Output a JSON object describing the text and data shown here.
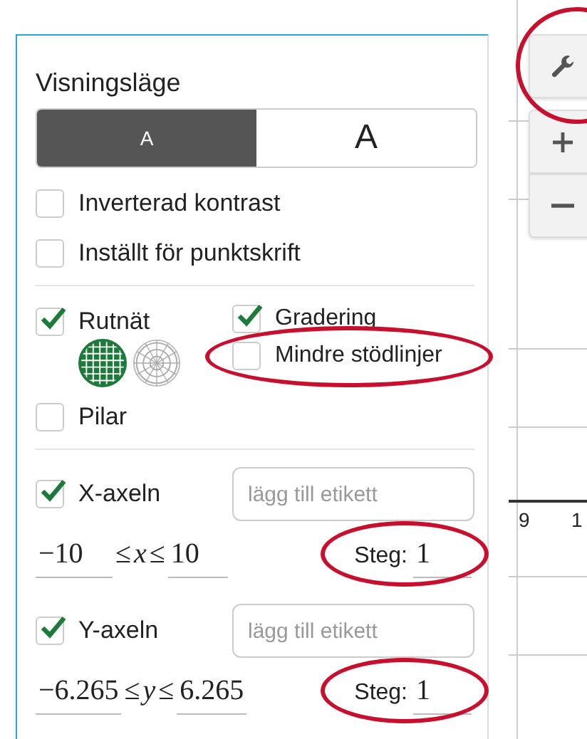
{
  "settings_panel": {
    "title": "Visningsläge",
    "display_modes": [
      {
        "label": "A",
        "kind": "small",
        "selected": true
      },
      {
        "label": "A",
        "kind": "large",
        "selected": false
      }
    ],
    "options": [
      {
        "label": "Inverterad kontrast",
        "checked": false
      },
      {
        "label": "Inställt för punktskrift",
        "checked": false
      }
    ],
    "grid": {
      "label": "Rutnät",
      "checked": true,
      "grid_types": [
        {
          "kind": "cartesian",
          "selected": true
        },
        {
          "kind": "polar",
          "selected": false
        }
      ],
      "sub_options": [
        {
          "label": "Gradering",
          "checked": true,
          "highlighted": false
        },
        {
          "label": "Mindre stödlinjer",
          "checked": false,
          "highlighted": true
        }
      ]
    },
    "arrows": {
      "label": "Pilar",
      "checked": false
    },
    "axes": [
      {
        "label": "X-axeln",
        "checked": true,
        "placeholder": "lägg till etikett",
        "min": "−10",
        "relations": [
          "≤",
          "≤"
        ],
        "variable": "x",
        "max": "10",
        "step_label": "Steg:",
        "step": "1",
        "step_highlighted": true
      },
      {
        "label": "Y-axeln",
        "checked": true,
        "placeholder": "lägg till etikett",
        "min": "−6.265",
        "relations": [
          "≤",
          "≤"
        ],
        "variable": "y",
        "max": "6.265",
        "step_label": "Steg:",
        "step": "1",
        "step_highlighted": true
      }
    ]
  },
  "graph": {
    "tick_labels": [
      "9",
      "1"
    ],
    "tools": [
      {
        "kind": "settings",
        "highlighted": true
      },
      {
        "kind": "zoom-in",
        "highlighted": false
      },
      {
        "kind": "zoom-out",
        "highlighted": false
      }
    ]
  }
}
